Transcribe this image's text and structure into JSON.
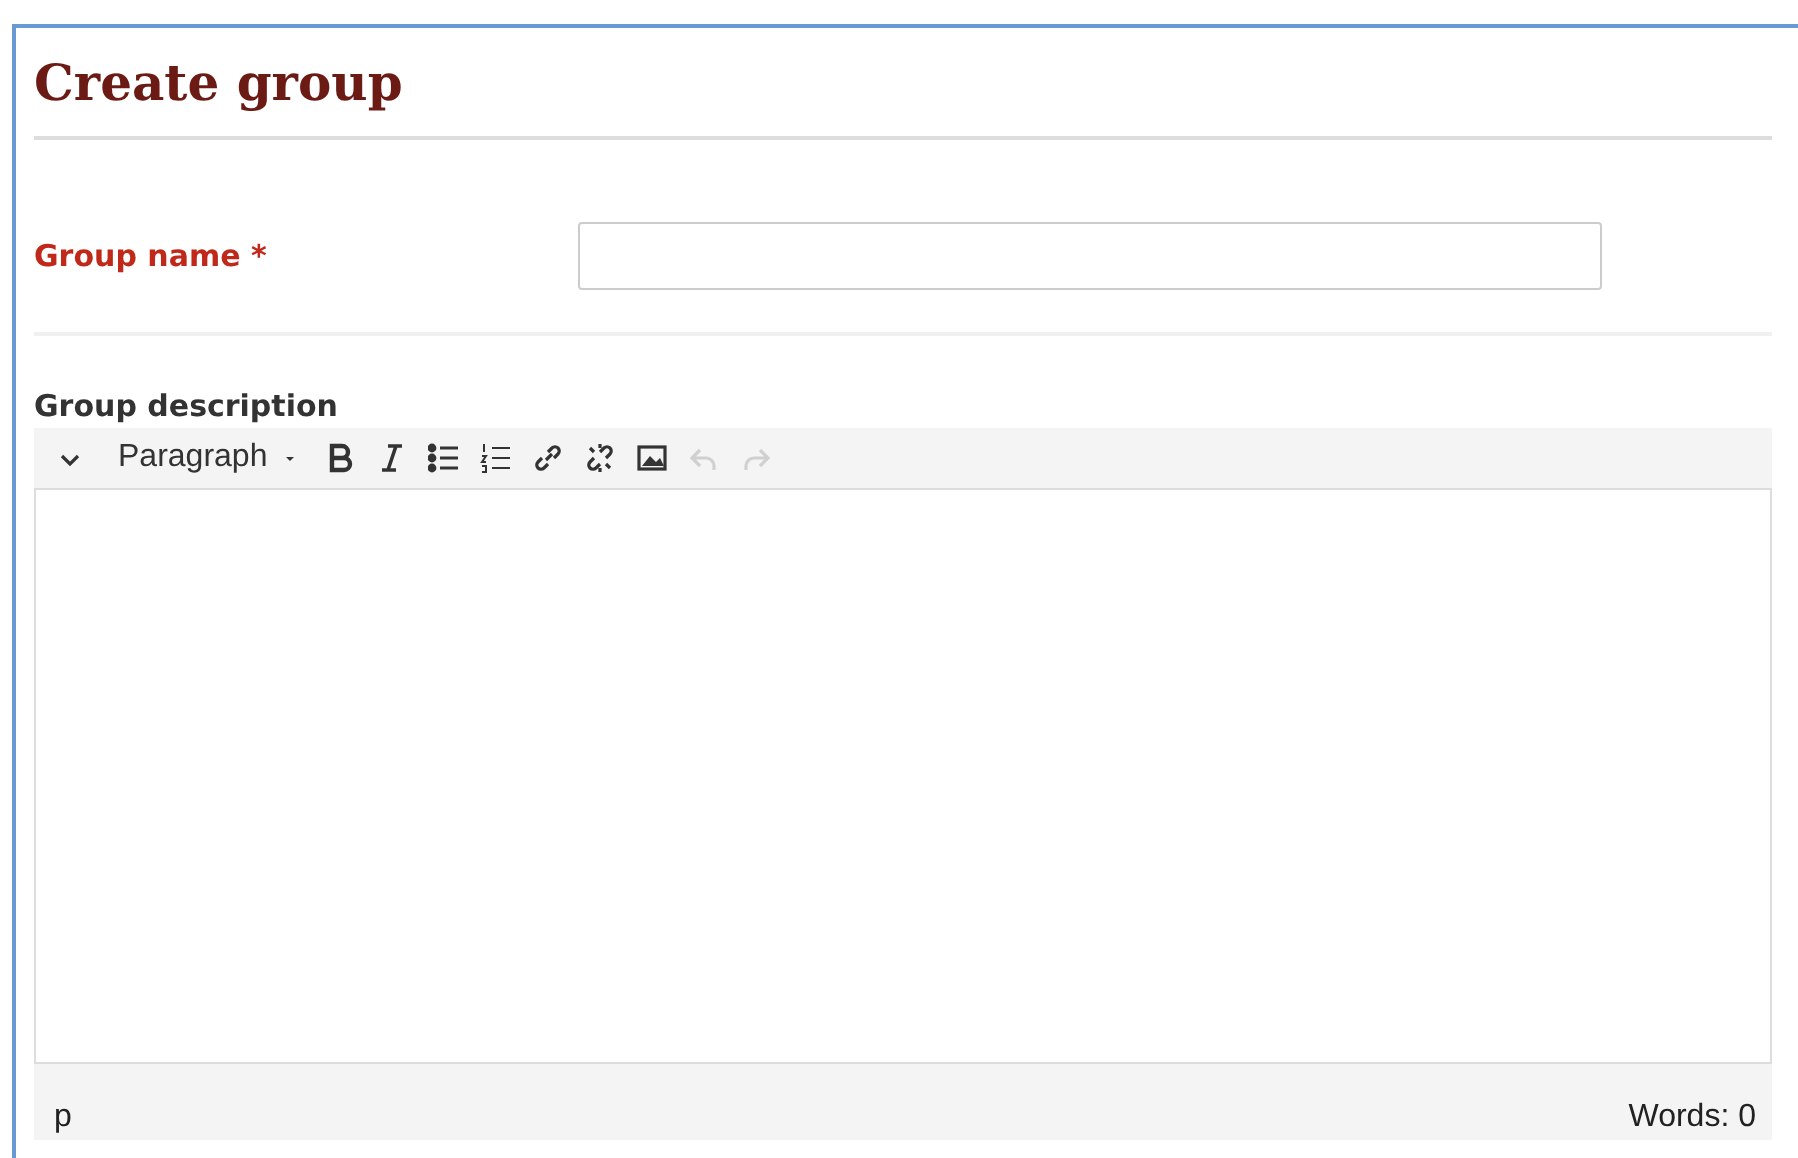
{
  "title": "Create group",
  "name_field": {
    "label": "Group name",
    "required_mark": "*"
  },
  "description": {
    "label": "Group description",
    "toolbar": [
      {
        "kind": "collapse",
        "disabled": false
      },
      {
        "kind": "format",
        "label": "Paragraph",
        "disabled": false
      },
      {
        "kind": "bold",
        "disabled": false
      },
      {
        "kind": "italic",
        "disabled": false
      },
      {
        "kind": "bullets",
        "disabled": false
      },
      {
        "kind": "numbers",
        "disabled": false
      },
      {
        "kind": "link",
        "disabled": false
      },
      {
        "kind": "unlink",
        "disabled": false
      },
      {
        "kind": "image",
        "disabled": false
      },
      {
        "kind": "undo",
        "disabled": true
      },
      {
        "kind": "redo",
        "disabled": true
      }
    ],
    "path": "p",
    "word_count": "Words: 0"
  }
}
